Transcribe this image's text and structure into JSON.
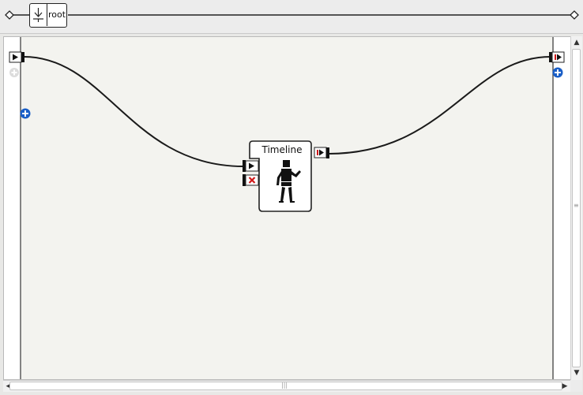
{
  "breadcrumb": {
    "root_label": "root",
    "root_icon": "behavior-root-icon"
  },
  "node": {
    "title": "Timeline",
    "icon": "robot-figure-icon",
    "inputs": [
      "play-input-icon",
      "stop-input-icon"
    ],
    "outputs": [
      "stopped-output-icon"
    ]
  },
  "diagram_ports": {
    "left_input": "play-port-icon",
    "right_output": "stopped-port-icon",
    "add_input": "add-input-icon",
    "add_output": "add-output-icon",
    "add_left_disabled": "add-disabled-icon"
  },
  "colors": {
    "canvas": "#f3f3ef",
    "wire": "#1a1a1a",
    "add_blue": "#1b5fc7",
    "stop_red": "#d01818"
  }
}
